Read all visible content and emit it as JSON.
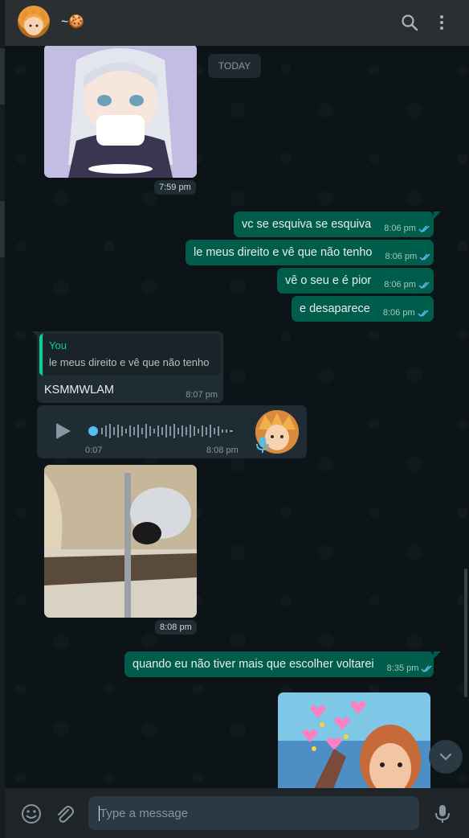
{
  "header": {
    "contact_name": "~🍪",
    "search_icon": "search-icon",
    "menu_icon": "menu-dots-icon"
  },
  "chat": {
    "date_chip": "TODAY",
    "image1": {
      "time": "7:59 pm"
    },
    "outgoing": [
      {
        "text": "vc se esquiva se esquiva",
        "time": "8:06 pm"
      },
      {
        "text": "le meus direito e vê que não tenho",
        "time": "8:06 pm"
      },
      {
        "text": "vê o seu e é pior",
        "time": "8:06 pm"
      },
      {
        "text": "e desaparece",
        "time": "8:06 pm"
      }
    ],
    "reply": {
      "quote_author": "You",
      "quote_text": "le meus direito e vê que não tenho",
      "text": "KSMMWLAM",
      "time": "8:07 pm"
    },
    "audio": {
      "duration": "0:07",
      "time": "8:08 pm",
      "progress": 0.0
    },
    "image2": {
      "time": "8:08 pm"
    },
    "outgoing_late": {
      "text": "quando eu não tiver mais que escolher voltarei",
      "time": "8:35 pm"
    }
  },
  "composer": {
    "placeholder": "Type a message",
    "emoji_icon": "emoji-icon",
    "attach_icon": "paperclip-icon",
    "mic_icon": "microphone-icon"
  },
  "colors": {
    "outgoing_bubble": "#005c4b",
    "incoming_bubble": "#1f2c33",
    "header_bg": "#2a2f32",
    "accent": "#06cf9c",
    "read_ticks": "#53bdeb"
  }
}
